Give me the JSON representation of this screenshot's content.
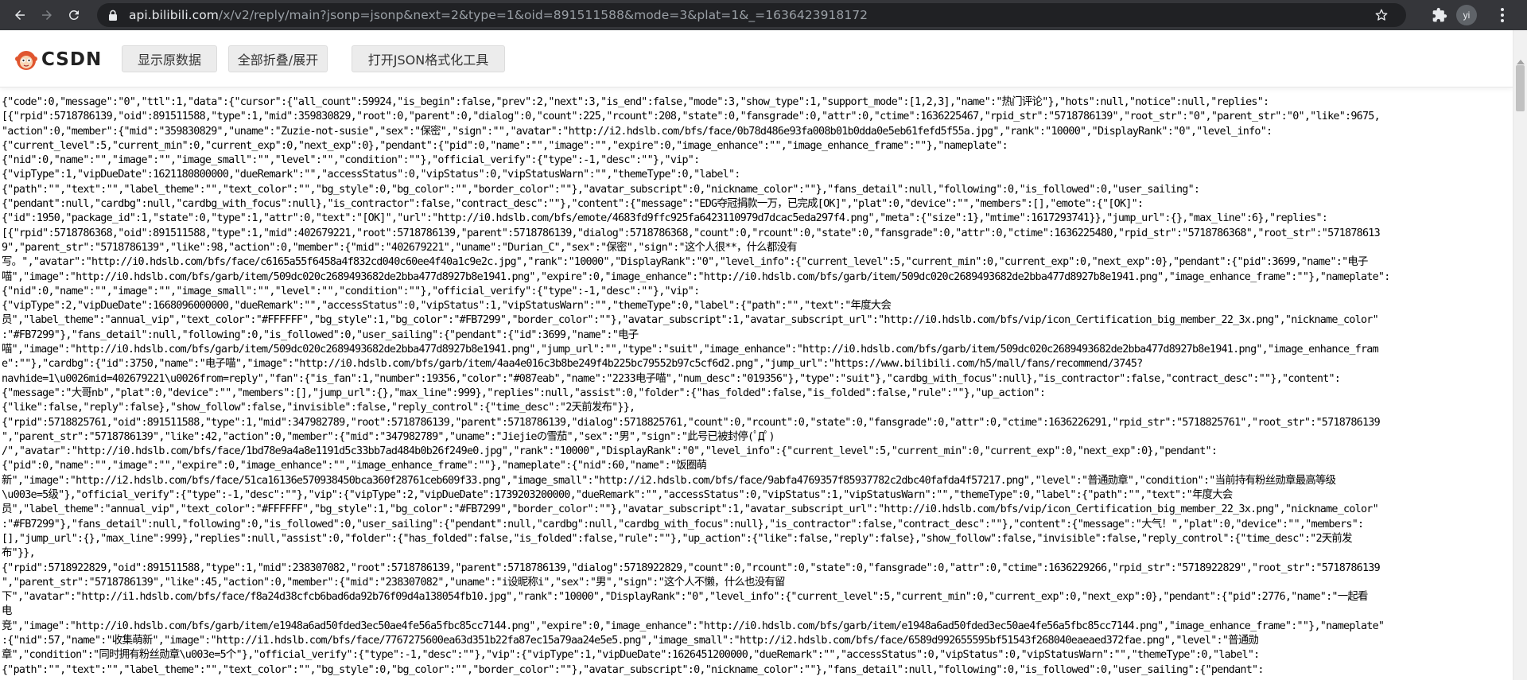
{
  "browser": {
    "url_host": "api.bilibili.com",
    "url_path": "/x/v2/reply/main?jsonp=jsonp&next=2&type=1&oid=891511588&mode=3&plat=1&_=1636423918172",
    "profile_initials": "yi",
    "icons": [
      "back-icon",
      "forward-icon",
      "reload-icon",
      "lock-icon",
      "star-icon",
      "extensions-icon",
      "menu-icon"
    ]
  },
  "toolbar": {
    "logo_text": "CSDN",
    "buttons": [
      "显示原数据",
      "全部折叠/展开",
      "打开JSON格式化工具"
    ]
  },
  "json_lines": [
    "{\"code\":0,\"message\":\"0\",\"ttl\":1,\"data\":{\"cursor\":{\"all_count\":59924,\"is_begin\":false,\"prev\":2,\"next\":3,\"is_end\":false,\"mode\":3,\"show_type\":1,\"support_mode\":[1,2,3],\"name\":\"热门评论\"},\"hots\":null,\"notice\":null,\"replies\":",
    "[{\"rpid\":5718786139,\"oid\":891511588,\"type\":1,\"mid\":359830829,\"root\":0,\"parent\":0,\"dialog\":0,\"count\":225,\"rcount\":208,\"state\":0,\"fansgrade\":0,\"attr\":0,\"ctime\":1636225467,\"rpid_str\":\"5718786139\",\"root_str\":\"0\",\"parent_str\":\"0\",\"like\":9675,",
    "\"action\":0,\"member\":{\"mid\":\"359830829\",\"uname\":\"Zuzie-not-susie\",\"sex\":\"保密\",\"sign\":\"\",\"avatar\":\"http://i2.hdslb.com/bfs/face/0b78d486e93fa008b01b0dda0e5eb61fefd5f55a.jpg\",\"rank\":\"10000\",\"DisplayRank\":\"0\",\"level_info\":",
    "{\"current_level\":5,\"current_min\":0,\"current_exp\":0,\"next_exp\":0},\"pendant\":{\"pid\":0,\"name\":\"\",\"image\":\"\",\"expire\":0,\"image_enhance\":\"\",\"image_enhance_frame\":\"\"},\"nameplate\":",
    "{\"nid\":0,\"name\":\"\",\"image\":\"\",\"image_small\":\"\",\"level\":\"\",\"condition\":\"\"},\"official_verify\":{\"type\":-1,\"desc\":\"\"},\"vip\":",
    "{\"vipType\":1,\"vipDueDate\":1621180800000,\"dueRemark\":\"\",\"accessStatus\":0,\"vipStatus\":0,\"vipStatusWarn\":\"\",\"themeType\":0,\"label\":",
    "{\"path\":\"\",\"text\":\"\",\"label_theme\":\"\",\"text_color\":\"\",\"bg_style\":0,\"bg_color\":\"\",\"border_color\":\"\"},\"avatar_subscript\":0,\"nickname_color\":\"\"},\"fans_detail\":null,\"following\":0,\"is_followed\":0,\"user_sailing\":",
    "{\"pendant\":null,\"cardbg\":null,\"cardbg_with_focus\":null},\"is_contractor\":false,\"contract_desc\":\"\"},\"content\":{\"message\":\"EDG夺冠捐款一万，已完成[OK]\",\"plat\":0,\"device\":\"\",\"members\":[],\"emote\":{\"[OK]\":",
    "{\"id\":1950,\"package_id\":1,\"state\":0,\"type\":1,\"attr\":0,\"text\":\"[OK]\",\"url\":\"http://i0.hdslb.com/bfs/emote/4683fd9ffc925fa6423110979d7dcac5eda297f4.png\",\"meta\":{\"size\":1},\"mtime\":1617293741}},\"jump_url\":{},\"max_line\":6},\"replies\":",
    "[{\"rpid\":5718786368,\"oid\":891511588,\"type\":1,\"mid\":402679221,\"root\":5718786139,\"parent\":5718786139,\"dialog\":5718786368,\"count\":0,\"rcount\":0,\"state\":0,\"fansgrade\":0,\"attr\":0,\"ctime\":1636225480,\"rpid_str\":\"5718786368\",\"root_str\":\"571878613",
    "9\",\"parent_str\":\"5718786139\",\"like\":98,\"action\":0,\"member\":{\"mid\":\"402679221\",\"uname\":\"Durian_C\",\"sex\":\"保密\",\"sign\":\"这个人很**，什么都没有",
    "写。\",\"avatar\":\"http://i0.hdslb.com/bfs/face/c6165a55f6458a4f832cd040c60ee4f40a1c9e2c.jpg\",\"rank\":\"10000\",\"DisplayRank\":\"0\",\"level_info\":{\"current_level\":5,\"current_min\":0,\"current_exp\":0,\"next_exp\":0},\"pendant\":{\"pid\":3699,\"name\":\"电子",
    "喵\",\"image\":\"http://i0.hdslb.com/bfs/garb/item/509dc020c2689493682de2bba477d8927b8e1941.png\",\"expire\":0,\"image_enhance\":\"http://i0.hdslb.com/bfs/garb/item/509dc020c2689493682de2bba477d8927b8e1941.png\",\"image_enhance_frame\":\"\"},\"nameplate\":",
    "{\"nid\":0,\"name\":\"\",\"image\":\"\",\"image_small\":\"\",\"level\":\"\",\"condition\":\"\"},\"official_verify\":{\"type\":-1,\"desc\":\"\"},\"vip\":",
    "{\"vipType\":2,\"vipDueDate\":1668096000000,\"dueRemark\":\"\",\"accessStatus\":0,\"vipStatus\":1,\"vipStatusWarn\":\"\",\"themeType\":0,\"label\":{\"path\":\"\",\"text\":\"年度大会",
    "员\",\"label_theme\":\"annual_vip\",\"text_color\":\"#FFFFFF\",\"bg_style\":1,\"bg_color\":\"#FB7299\",\"border_color\":\"\"},\"avatar_subscript\":1,\"avatar_subscript_url\":\"http://i0.hdslb.com/bfs/vip/icon_Certification_big_member_22_3x.png\",\"nickname_color\"",
    ":\"#FB7299\"},\"fans_detail\":null,\"following\":0,\"is_followed\":0,\"user_sailing\":{\"pendant\":{\"id\":3699,\"name\":\"电子",
    "喵\",\"image\":\"http://i0.hdslb.com/bfs/garb/item/509dc020c2689493682de2bba477d8927b8e1941.png\",\"jump_url\":\"\",\"type\":\"suit\",\"image_enhance\":\"http://i0.hdslb.com/bfs/garb/item/509dc020c2689493682de2bba477d8927b8e1941.png\",\"image_enhance_fram",
    "e\":\"\"},\"cardbg\":{\"id\":3750,\"name\":\"电子喵\",\"image\":\"http://i0.hdslb.com/bfs/garb/item/4aa4e016c3b8be249f4b225bc79552b97c5cf6d2.png\",\"jump_url\":\"https://www.bilibili.com/h5/mall/fans/recommend/3745?",
    "navhide=1\\u0026mid=402679221\\u0026from=reply\",\"fan\":{\"is_fan\":1,\"number\":19356,\"color\":\"#087eab\",\"name\":\"2233电子喵\",\"num_desc\":\"019356\"},\"type\":\"suit\"},\"cardbg_with_focus\":null},\"is_contractor\":false,\"contract_desc\":\"\"},\"content\":",
    "{\"message\":\"大哥nb\",\"plat\":0,\"device\":\"\",\"members\":[],\"jump_url\":{},\"max_line\":999},\"replies\":null,\"assist\":0,\"folder\":{\"has_folded\":false,\"is_folded\":false,\"rule\":\"\"},\"up_action\":",
    "{\"like\":false,\"reply\":false},\"show_follow\":false,\"invisible\":false,\"reply_control\":{\"time_desc\":\"2天前发布\"}},",
    "{\"rpid\":5718825761,\"oid\":891511588,\"type\":1,\"mid\":347982789,\"root\":5718786139,\"parent\":5718786139,\"dialog\":5718825761,\"count\":0,\"rcount\":0,\"state\":0,\"fansgrade\":0,\"attr\":0,\"ctime\":1636226291,\"rpid_str\":\"5718825761\",\"root_str\":\"5718786139",
    "\",\"parent_str\":\"5718786139\",\"like\":42,\"action\":0,\"member\":{\"mid\":\"347982789\",\"uname\":\"Jiejieの雪茄\",\"sex\":\"男\",\"sign\":\"此号已被封停(ﾟДﾟ)",
    "/\",\"avatar\":\"http://i0.hdslb.com/bfs/face/1bd78e9a4a8e1191d5c33bb7ad484b0b26f249e0.jpg\",\"rank\":\"10000\",\"DisplayRank\":\"0\",\"level_info\":{\"current_level\":5,\"current_min\":0,\"current_exp\":0,\"next_exp\":0},\"pendant\":",
    "{\"pid\":0,\"name\":\"\",\"image\":\"\",\"expire\":0,\"image_enhance\":\"\",\"image_enhance_frame\":\"\"},\"nameplate\":{\"nid\":60,\"name\":\"饭圈萌",
    "新\",\"image\":\"http://i2.hdslb.com/bfs/face/51ca16136e570938450bca360f28761ceb609f33.png\",\"image_small\":\"http://i2.hdslb.com/bfs/face/9abfa4769357f85937782c2dbc40fafda4f57217.png\",\"level\":\"普通勋章\",\"condition\":\"当前持有粉丝勋章最高等级",
    "\\u003e=5级\"},\"official_verify\":{\"type\":-1,\"desc\":\"\"},\"vip\":{\"vipType\":2,\"vipDueDate\":1739203200000,\"dueRemark\":\"\",\"accessStatus\":0,\"vipStatus\":1,\"vipStatusWarn\":\"\",\"themeType\":0,\"label\":{\"path\":\"\",\"text\":\"年度大会",
    "员\",\"label_theme\":\"annual_vip\",\"text_color\":\"#FFFFFF\",\"bg_style\":1,\"bg_color\":\"#FB7299\",\"border_color\":\"\"},\"avatar_subscript\":1,\"avatar_subscript_url\":\"http://i0.hdslb.com/bfs/vip/icon_Certification_big_member_22_3x.png\",\"nickname_color\"",
    ":\"#FB7299\"},\"fans_detail\":null,\"following\":0,\"is_followed\":0,\"user_sailing\":{\"pendant\":null,\"cardbg\":null,\"cardbg_with_focus\":null},\"is_contractor\":false,\"contract_desc\":\"\"},\"content\":{\"message\":\"大气！\",\"plat\":0,\"device\":\"\",\"members\":",
    "[],\"jump_url\":{},\"max_line\":999},\"replies\":null,\"assist\":0,\"folder\":{\"has_folded\":false,\"is_folded\":false,\"rule\":\"\"},\"up_action\":{\"like\":false,\"reply\":false},\"show_follow\":false,\"invisible\":false,\"reply_control\":{\"time_desc\":\"2天前发",
    "布\"}},",
    "{\"rpid\":5718922829,\"oid\":891511588,\"type\":1,\"mid\":238307082,\"root\":5718786139,\"parent\":5718786139,\"dialog\":5718922829,\"count\":0,\"rcount\":0,\"state\":0,\"fansgrade\":0,\"attr\":0,\"ctime\":1636229266,\"rpid_str\":\"5718922829\",\"root_str\":\"5718786139",
    "\",\"parent_str\":\"5718786139\",\"like\":45,\"action\":0,\"member\":{\"mid\":\"238307082\",\"uname\":\"i设昵称i\",\"sex\":\"男\",\"sign\":\"这个人不懒，什么也没有留",
    "下\",\"avatar\":\"http://i1.hdslb.com/bfs/face/f8a24d38cfcb6bad6da92b76f09d4a138054fb10.jpg\",\"rank\":\"10000\",\"DisplayRank\":\"0\",\"level_info\":{\"current_level\":5,\"current_min\":0,\"current_exp\":0,\"next_exp\":0},\"pendant\":{\"pid\":2776,\"name\":\"一起看",
    "电",
    "竞\",\"image\":\"http://i0.hdslb.com/bfs/garb/item/e1948a6ad50fded3ec50ae4fe56a5fbc85cc7144.png\",\"expire\":0,\"image_enhance\":\"http://i0.hdslb.com/bfs/garb/item/e1948a6ad50fded3ec50ae4fe56a5fbc85cc7144.png\",\"image_enhance_frame\":\"\"},\"nameplate\"",
    ":{\"nid\":57,\"name\":\"收集萌新\",\"image\":\"http://i1.hdslb.com/bfs/face/7767275600ea63d351b22fa87ec15a79aa24e5e5.png\",\"image_small\":\"http://i2.hdslb.com/bfs/face/6589d992655595bf51543f268040eaeaed372fae.png\",\"level\":\"普通勋",
    "章\",\"condition\":\"同时拥有粉丝勋章\\u003e=5个\"},\"official_verify\":{\"type\":-1,\"desc\":\"\"},\"vip\":{\"vipType\":1,\"vipDueDate\":1626451200000,\"dueRemark\":\"\",\"accessStatus\":0,\"vipStatus\":0,\"vipStatusWarn\":\"\",\"themeType\":0,\"label\":",
    "{\"path\":\"\",\"text\":\"\",\"label_theme\":\"\",\"text_color\":\"\",\"bg_style\":0,\"bg_color\":\"\",\"border_color\":\"\"},\"avatar_subscript\":0,\"nickname_color\":\"\"},\"fans_detail\":null,\"following\":0,\"is_followed\":0,\"user_sailing\":{\"pendant\":"
  ]
}
